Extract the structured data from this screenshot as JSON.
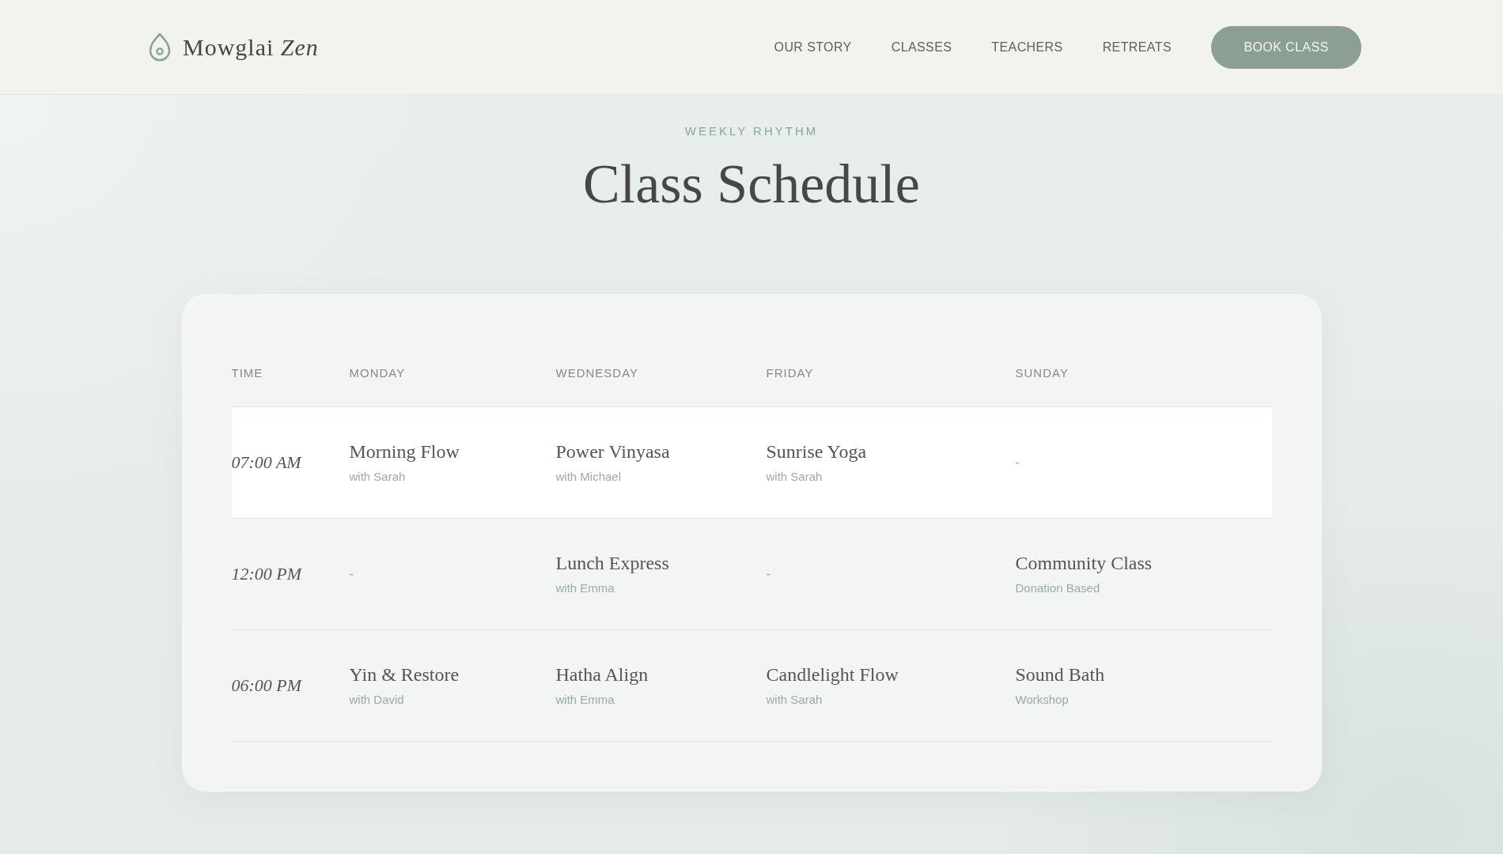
{
  "header": {
    "logo": "Mowglai *Zen*",
    "nav": [
      {
        "label": "OUR STORY"
      },
      {
        "label": "CLASSES"
      },
      {
        "label": "TEACHERS"
      },
      {
        "label": "RETREATS"
      }
    ],
    "cta": "BOOK CLASS"
  },
  "hero": {
    "eyebrow": "WEEKLY RHYTHM",
    "title": "Class Schedule"
  },
  "schedule": {
    "columns": [
      "TIME",
      "MONDAY",
      "WEDNESDAY",
      "FRIDAY",
      "SUNDAY"
    ],
    "rows": [
      {
        "highlighted": true,
        "cells": [
          {
            "kind": "time",
            "text": "07:00 AM"
          },
          {
            "kind": "class",
            "title": "Morning Flow",
            "subtitle": "with Sarah"
          },
          {
            "kind": "class",
            "title": "Power Vinyasa",
            "subtitle": "with Michael"
          },
          {
            "kind": "class",
            "title": "Sunrise Yoga",
            "subtitle": "with Sarah"
          },
          {
            "kind": "empty",
            "text": "-"
          }
        ]
      },
      {
        "highlighted": false,
        "cells": [
          {
            "kind": "time",
            "text": "12:00 PM"
          },
          {
            "kind": "empty",
            "text": "-"
          },
          {
            "kind": "class",
            "title": "Lunch Express",
            "subtitle": "with Emma"
          },
          {
            "kind": "empty",
            "text": "-"
          },
          {
            "kind": "class",
            "title": "Community Class",
            "subtitle": "Donation Based"
          }
        ]
      },
      {
        "highlighted": false,
        "cells": [
          {
            "kind": "time",
            "text": "06:00 PM"
          },
          {
            "kind": "class",
            "title": "Yin & Restore",
            "subtitle": "with David"
          },
          {
            "kind": "class",
            "title": "Hatha Align",
            "subtitle": "with Emma"
          },
          {
            "kind": "class",
            "title": "Candlelight Flow",
            "subtitle": "with Sarah"
          },
          {
            "kind": "class",
            "title": "Sound Bath",
            "subtitle": "Workshop"
          }
        ]
      }
    ]
  }
}
